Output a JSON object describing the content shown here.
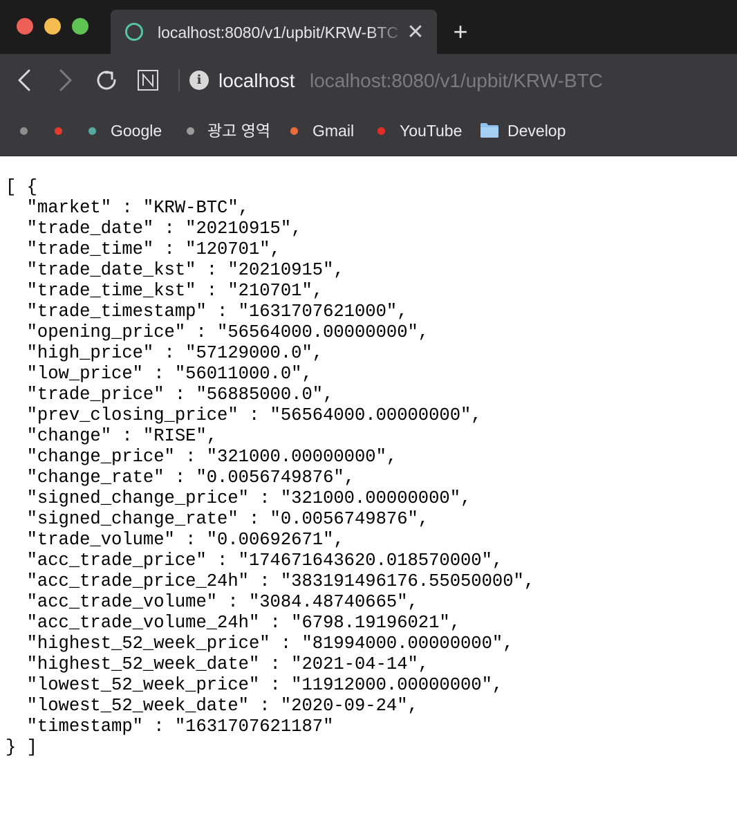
{
  "window": {
    "traffic_colors": {
      "close": "#ee5f57",
      "minimize": "#f5bd4f",
      "zoom": "#5fc454"
    }
  },
  "tab": {
    "title": "localhost:8080/v1/upbit/KRW-BTC",
    "favicon": "circle-icon",
    "close_icon": "close-icon",
    "close_glyph": "✕",
    "new_tab_glyph": "+"
  },
  "toolbar": {
    "back_icon": "chevron-left-icon",
    "forward_icon": "chevron-right-icon",
    "reload_icon": "reload-icon",
    "reader_icon": "n-extension-icon",
    "info_glyph": "i",
    "address_host": "localhost",
    "address_url": "localhost:8080/v1/upbit/KRW-BTC"
  },
  "bookmarks": [
    {
      "label": "",
      "dot_color": "#8e8e8e"
    },
    {
      "label": "",
      "dot_color": "#e33b2e"
    },
    {
      "label": "Google",
      "dot_color": "#56a8a0"
    },
    {
      "label": "광고 영역",
      "dot_color": "#9a9a9a"
    },
    {
      "label": "Gmail",
      "dot_color": "#ea6b3c"
    },
    {
      "label": "YouTube",
      "dot_color": "#e52d27"
    },
    {
      "label": "Develop",
      "icon": "folder-icon"
    }
  ],
  "json_lines": [
    "[ {",
    "  \"market\" : \"KRW-BTC\",",
    "  \"trade_date\" : \"20210915\",",
    "  \"trade_time\" : \"120701\",",
    "  \"trade_date_kst\" : \"20210915\",",
    "  \"trade_time_kst\" : \"210701\",",
    "  \"trade_timestamp\" : \"1631707621000\",",
    "  \"opening_price\" : \"56564000.00000000\",",
    "  \"high_price\" : \"57129000.0\",",
    "  \"low_price\" : \"56011000.0\",",
    "  \"trade_price\" : \"56885000.0\",",
    "  \"prev_closing_price\" : \"56564000.00000000\",",
    "  \"change\" : \"RISE\",",
    "  \"change_price\" : \"321000.00000000\",",
    "  \"change_rate\" : \"0.0056749876\",",
    "  \"signed_change_price\" : \"321000.00000000\",",
    "  \"signed_change_rate\" : \"0.0056749876\",",
    "  \"trade_volume\" : \"0.00692671\",",
    "  \"acc_trade_price\" : \"174671643620.018570000\",",
    "  \"acc_trade_price_24h\" : \"383191496176.55050000\",",
    "  \"acc_trade_volume\" : \"3084.48740665\",",
    "  \"acc_trade_volume_24h\" : \"6798.19196021\",",
    "  \"highest_52_week_price\" : \"81994000.00000000\",",
    "  \"highest_52_week_date\" : \"2021-04-14\",",
    "  \"lowest_52_week_price\" : \"11912000.00000000\",",
    "  \"lowest_52_week_date\" : \"2020-09-24\",",
    "  \"timestamp\" : \"1631707621187\"",
    "} ]"
  ]
}
